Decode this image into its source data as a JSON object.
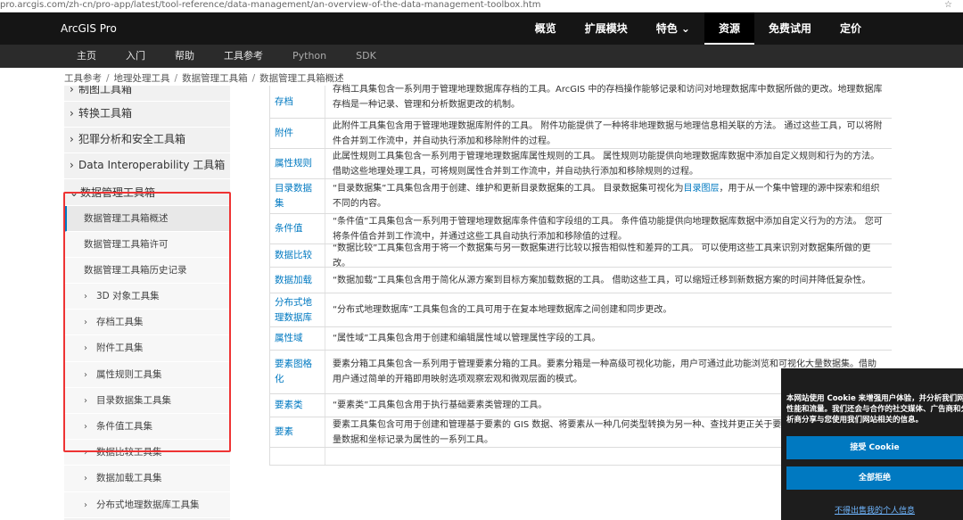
{
  "browser": {
    "url": "pro.arcgis.com/zh-cn/pro-app/latest/tool-reference/data-management/an-overview-of-the-data-management-toolbox.htm"
  },
  "header": {
    "brand": "ArcGIS Pro",
    "nav": [
      "概览",
      "扩展模块",
      "特色 ⌄",
      "资源",
      "免费试用",
      "定价"
    ],
    "active": "资源"
  },
  "subnav": {
    "items": [
      "主页",
      "入门",
      "帮助",
      "工具参考",
      "Python",
      "SDK"
    ]
  },
  "breadcrumb": [
    "工具参考",
    "地理处理工具",
    "数据管理工具箱",
    "数据管理工具箱概述"
  ],
  "sidebar": {
    "top_items": [
      "制图工具箱",
      "转换工具箱",
      "犯罪分析和安全工具箱",
      "Data Interoperability 工具箱"
    ],
    "open_item": "数据管理工具箱",
    "sub_pages": [
      "数据管理工具箱概述",
      "数据管理工具箱许可",
      "数据管理工具箱历史记录"
    ],
    "toolsets": [
      "3D 对象工具集",
      "存档工具集",
      "附件工具集",
      "属性规则工具集",
      "目录数据集工具集",
      "条件值工具集",
      "数据比较工具集",
      "数据加载工具集",
      "分布式地理数据库工具集"
    ]
  },
  "table": {
    "rows": [
      {
        "name": "存档",
        "desc": "存档工具集包含一系列用于管理地理数据库存档的工具。ArcGIS 中的存档操作能够记录和访问对地理数据库中数据所做的更改。地理数据库存档是一种记录、管理和分析数据更改的机制。"
      },
      {
        "name": "附件",
        "desc": "此附件工具集包含用于管理地理数据库附件的工具。 附件功能提供了一种将非地理数据与地理信息相关联的方法。 通过这些工具，可以将附件合并到工作流中，并自动执行添加和移除附件的过程。"
      },
      {
        "name": "属性规则",
        "desc": "此属性规则工具集包含一系列用于管理地理数据库属性规则的工具。 属性规则功能提供向地理数据库数据中添加自定义规则和行为的方法。 借助这些地理处理工具，可将规则属性合并到工作流中，并自动执行添加和移除规则的过程。"
      },
      {
        "name": "目录数据集",
        "desc_pre": "“目录数据集”工具集包含用于创建、维护和更新目录数据集的工具。 目录数据集可视化为",
        "desc_link": "目录图层",
        "desc_post": "，用于从一个集中管理的源中探索和组织不同的内容。"
      },
      {
        "name": "条件值",
        "desc": "“条件值”工具集包含一系列用于管理地理数据库条件值和字段组的工具。 条件值功能提供向地理数据库数据中添加自定义行为的方法。 您可将条件值合并到工作流中，并通过这些工具自动执行添加和移除值的过程。"
      },
      {
        "name": "数据比较",
        "desc": "“数据比较”工具集包含用于将一个数据集与另一数据集进行比较以报告相似性和差异的工具。 可以使用这些工具来识别对数据集所做的更改。"
      },
      {
        "name": "数据加载",
        "desc": "“数据加载”工具集包含用于简化从源方案到目标方案加载数据的工具。 借助这些工具，可以缩短迁移到新数据方案的时间并降低复杂性。"
      },
      {
        "name": "分布式地理数据库",
        "desc": "“分布式地理数据库”工具集包含的工具可用于在复本地理数据库之间创建和同步更改。"
      },
      {
        "name": "属性域",
        "desc": "“属性域”工具集包含用于创建和编辑属性域以管理属性字段的工具。"
      },
      {
        "name": "要素图格化",
        "desc": "要素分箱工具集包含一系列用于管理要素分箱的工具。要素分箱是一种高级可视化功能，用户可通过此功能浏览和可视化大量数据集。借助用户通过简单的开箱即用映射选项观察宏观和微观层面的模式。"
      },
      {
        "name": "要素类",
        "desc": "“要素类”工具集包含用于执行基础要素类管理的工具。"
      },
      {
        "name": "要素",
        "desc": "要素工具集包含可用于创建和管理基于要素的 GIS 数据、将要素从一种几何类型转换为另一种、查找并更正关于要素几何的问题以及计算大量数据和坐标记录为属性的一系列工具。"
      },
      {
        "name": "",
        "desc": ""
      }
    ]
  },
  "cookie": {
    "line1": "本网站使用 Cookie 来增强用户体验，并分析我们网站的",
    "line2": "性能和流量。我们还会与合作的社交媒体、广告商和分",
    "line3": "析商分享与您使用我们网站相关的信息。",
    "accept": "接受 Cookie",
    "reject": "全部拒绝",
    "link": "不得出售我的个人信息"
  }
}
